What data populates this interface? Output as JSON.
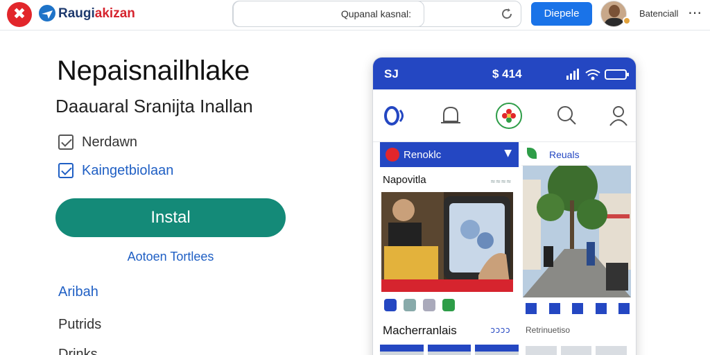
{
  "topbar": {
    "close_glyph": "✖",
    "brand_main": "Raugi",
    "brand_accent": "akizan",
    "search_text": "Qupanal kasnal:",
    "primary_button": "Diepele",
    "user_name": "Batenciall",
    "more_glyph": "⋯"
  },
  "hero": {
    "title": "Nepaisnailhlake",
    "subtitle": "Daauaral Sranijta Inallan",
    "options": [
      {
        "label": "Nerdawn",
        "checked": true
      },
      {
        "label": "Kaingetbiolaan",
        "checked": true
      }
    ],
    "install_label": "Instal",
    "secondary_link": "Aotoen Tortlees",
    "nav_links": [
      {
        "label": "Aribah",
        "color": "#1f5fc4"
      },
      {
        "label": "Putrids",
        "color": "#333333"
      },
      {
        "label": "Drinks",
        "color": "#333333"
      }
    ]
  },
  "phone": {
    "status_left": "SJ",
    "status_mid": "$ 414",
    "feed": {
      "card_label": "Renoklc",
      "card_sub": "Napovitla",
      "card_dots": "≈≈≈≈",
      "card2_title": "Macherranlais",
      "card2_dots": "ɔɔɔɔ",
      "right_label": "Reuals",
      "right_small": "Retrinuetiso"
    }
  },
  "colors": {
    "accent_blue": "#2447c2",
    "install_green": "#148a78",
    "brand_red": "#e2262b"
  },
  "icons": [
    "close-icon",
    "logo-icon",
    "reload-icon",
    "more-icon",
    "signal-icon",
    "wifi-icon",
    "battery-icon",
    "home-icon",
    "bell-icon",
    "flower-icon",
    "search-icon",
    "user-icon"
  ]
}
